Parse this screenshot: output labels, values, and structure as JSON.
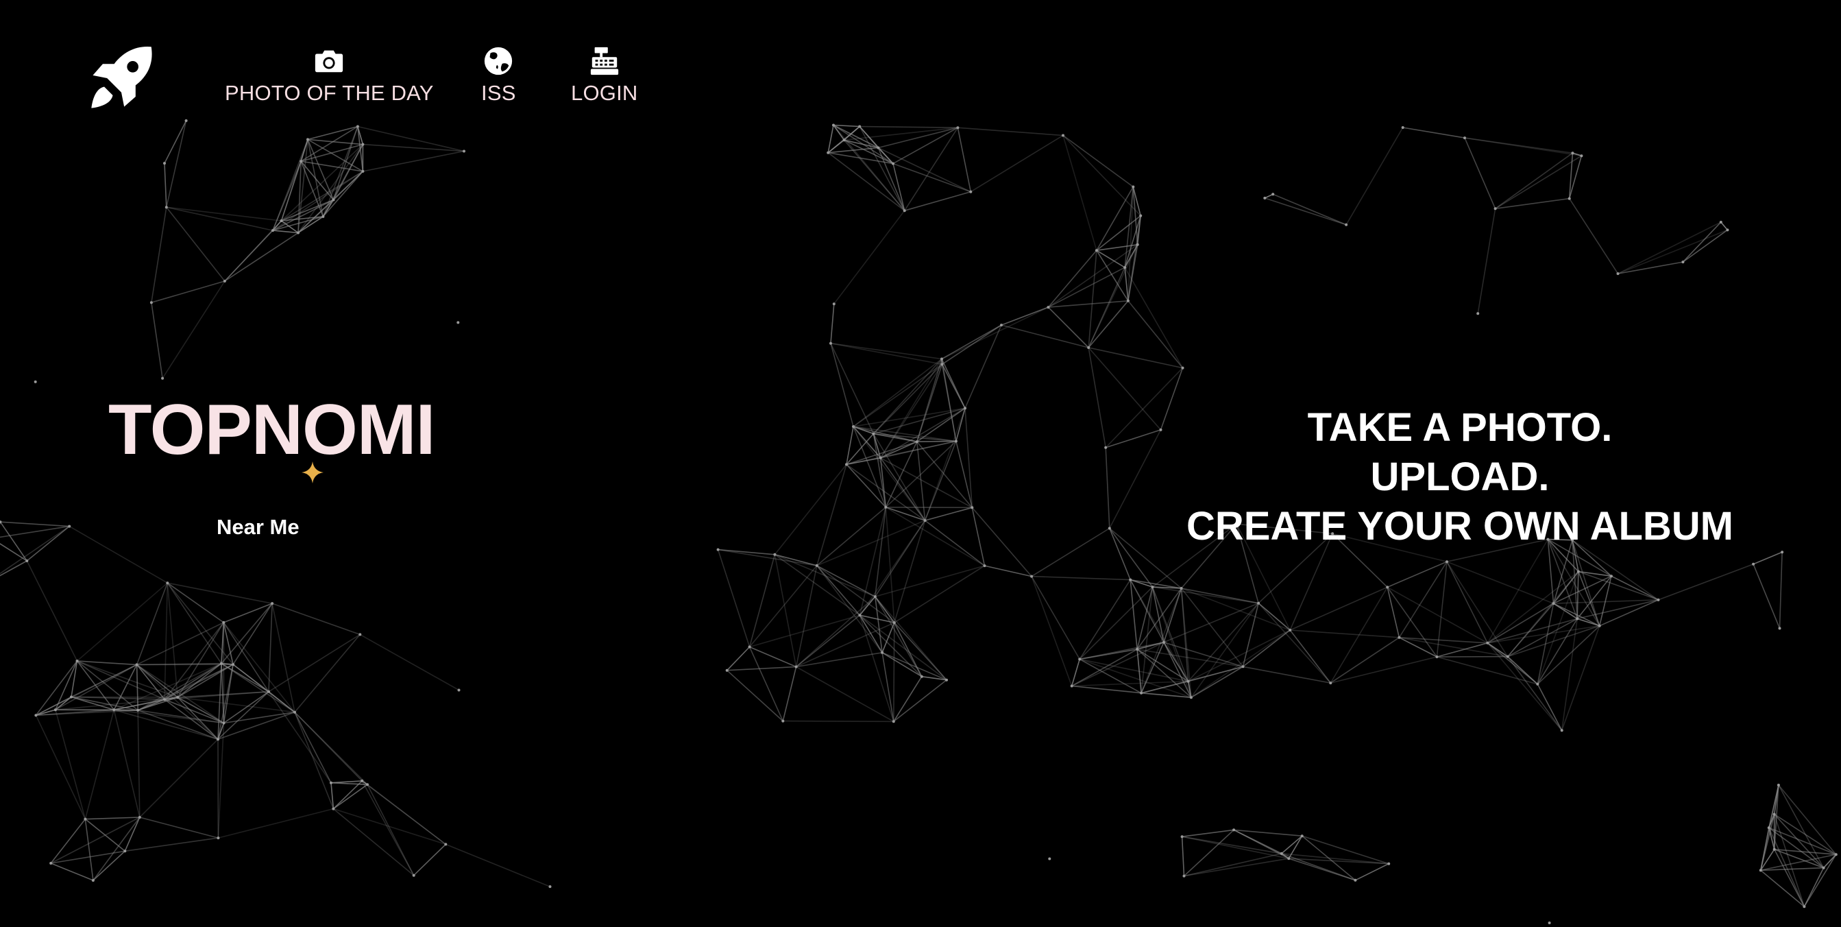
{
  "nav": {
    "logo_icon": "rocket-icon",
    "items": [
      {
        "label": "PHOTO OF THE DAY",
        "icon": "camera-icon"
      },
      {
        "label": "ISS",
        "icon": "globe-icon"
      },
      {
        "label": "LOGIN",
        "icon": "cash-register-icon"
      }
    ]
  },
  "hero": {
    "title": "TOPNOMI",
    "sparkle_icon": "sparkle-icon",
    "link_label": "Near Me"
  },
  "tagline": {
    "lines": [
      "TAKE A PHOTO.",
      "UPLOAD.",
      "CREATE YOUR OWN ALBUM"
    ]
  },
  "colors": {
    "background": "#000000",
    "nav_text": "#f7dfe3",
    "title_text": "#f8e3e6",
    "accent_star": "#e8b04a",
    "network_lines": "#8c8c8c"
  }
}
